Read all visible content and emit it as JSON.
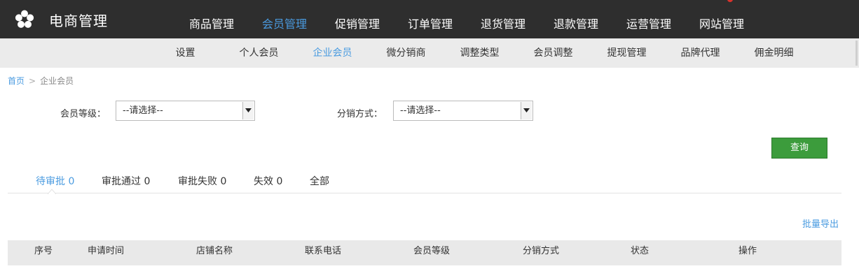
{
  "app": {
    "title": "电商管理"
  },
  "main_nav": [
    {
      "label": "商品管理",
      "active": false
    },
    {
      "label": "会员管理",
      "active": true
    },
    {
      "label": "促销管理",
      "active": false
    },
    {
      "label": "订单管理",
      "active": false
    },
    {
      "label": "退货管理",
      "active": false
    },
    {
      "label": "退款管理",
      "active": false
    },
    {
      "label": "运营管理",
      "active": false
    },
    {
      "label": "网站管理",
      "active": false
    }
  ],
  "sub_nav": [
    {
      "label": "设置",
      "active": false
    },
    {
      "label": "个人会员",
      "active": false
    },
    {
      "label": "企业会员",
      "active": true
    },
    {
      "label": "微分销商",
      "active": false
    },
    {
      "label": "调整类型",
      "active": false
    },
    {
      "label": "会员调整",
      "active": false
    },
    {
      "label": "提现管理",
      "active": false
    },
    {
      "label": "品牌代理",
      "active": false
    },
    {
      "label": "佣金明细",
      "active": false
    }
  ],
  "breadcrumb": {
    "home": "首页",
    "separator": ">",
    "current": "企业会员"
  },
  "filters": {
    "member_level": {
      "label": "会员等级：",
      "value": "--请选择--"
    },
    "distribution_mode": {
      "label": "分销方式：",
      "value": "--请选择--"
    }
  },
  "query_button": "查询",
  "tabs": [
    {
      "label": "待审批 0",
      "active": true
    },
    {
      "label": "审批通过 0",
      "active": false
    },
    {
      "label": "审批失败 0",
      "active": false
    },
    {
      "label": "失效 0",
      "active": false
    },
    {
      "label": "全部",
      "active": false
    }
  ],
  "export_link": "批量导出",
  "table": {
    "columns": [
      "序号",
      "申请时间",
      "店铺名称",
      "联系电话",
      "会员等级",
      "分销方式",
      "状态",
      "操作"
    ]
  },
  "colors": {
    "accent": "#4a9be0",
    "topbar": "#2e2e2e",
    "subnav": "#ebebeb",
    "query_button": "#3c9c3c"
  },
  "icons": {
    "brand": "flower-logo-icon",
    "select_arrow": "triangle-down-icon"
  }
}
